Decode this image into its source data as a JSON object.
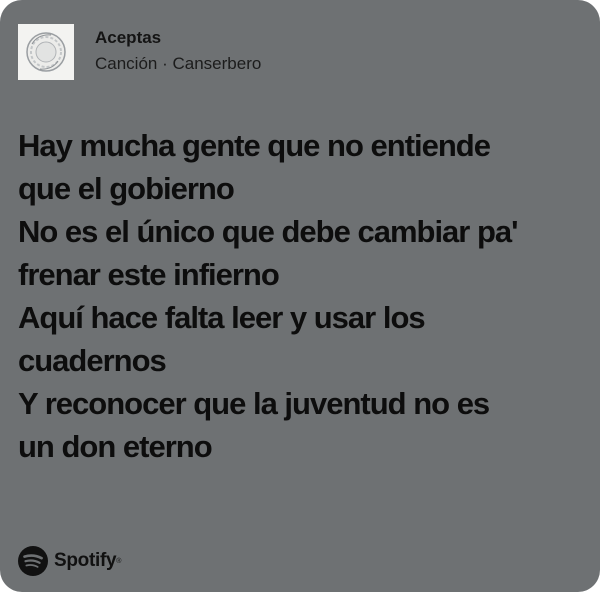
{
  "track": {
    "title": "Aceptas",
    "subtitle": "Canción · Canserbero"
  },
  "lyrics": [
    "Hay mucha gente que no entiende",
    "que el gobierno",
    "No es el único que debe cambiar pa'",
    "frenar este infierno",
    "Aquí hace falta leer y usar los",
    "cuadernos",
    "Y reconocer que la juventud no es",
    "un don eterno"
  ],
  "brand": {
    "name": "Spotify",
    "icon": "spotify-icon"
  },
  "colors": {
    "card_background": "#6e7173",
    "text": "#0d0d0d"
  }
}
